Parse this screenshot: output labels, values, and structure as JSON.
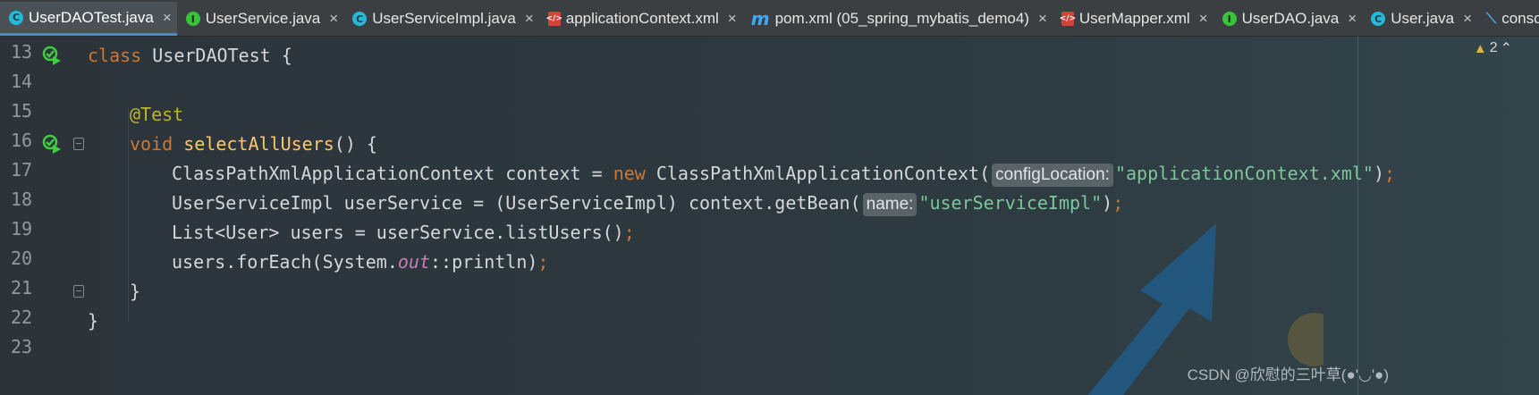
{
  "tabs": [
    {
      "label": "UserDAOTest.java",
      "icon": "class-icon",
      "active": true
    },
    {
      "label": "UserService.java",
      "icon": "interface-icon",
      "active": false
    },
    {
      "label": "UserServiceImpl.java",
      "icon": "class-icon",
      "active": false
    },
    {
      "label": "applicationContext.xml",
      "icon": "xml-file-icon",
      "active": false
    },
    {
      "label": "pom.xml (05_spring_mybatis_demo4)",
      "icon": "maven-icon",
      "active": false
    },
    {
      "label": "UserMapper.xml",
      "icon": "mapper-xml-icon",
      "active": false
    },
    {
      "label": "UserDAO.java",
      "icon": "interface-icon",
      "active": false
    },
    {
      "label": "User.java",
      "icon": "class-icon",
      "active": false
    },
    {
      "label": "console",
      "icon": "console-icon",
      "active": false
    }
  ],
  "close_glyph": "×",
  "warnings": {
    "count": "2"
  },
  "line_numbers": [
    "13",
    "14",
    "15",
    "16",
    "17",
    "18",
    "19",
    "20",
    "21",
    "22",
    "23"
  ],
  "code": {
    "l13": {
      "kw": "class",
      "name": "UserDAOTest",
      "brace": " {"
    },
    "l15": {
      "ann": "@Test"
    },
    "l16": {
      "kw": "void",
      "fn": "selectAllUsers",
      "rest": "() {"
    },
    "l17": {
      "a": "ClassPathXmlApplicationContext context = ",
      "kw": "new",
      "b": " ClassPathXmlApplicationContext(",
      "hint": "configLocation:",
      "str": "\"applicationContext.xml\"",
      "c": ")",
      "semi": ";"
    },
    "l18": {
      "a": "UserServiceImpl userService = (UserServiceImpl) context.getBean(",
      "hint": "name:",
      "str": "\"userServiceImpl\"",
      "c": ")",
      "semi": ";"
    },
    "l19": {
      "a": "List<User> users = userService.listUsers()",
      "semi": ";"
    },
    "l20": {
      "a": "users.forEach(System.",
      "ital": "out",
      "b": "::println)",
      "semi": ";"
    },
    "l21": {
      "a": "}"
    },
    "l22": {
      "a": "}"
    }
  },
  "watermark": "CSDN @欣慰的三叶草(●'◡'●)",
  "colors": {
    "keyword": "#cc7832",
    "function": "#ffc66d",
    "annotation": "#bbb529",
    "string": "#6a8759",
    "background": "#2b3338"
  }
}
